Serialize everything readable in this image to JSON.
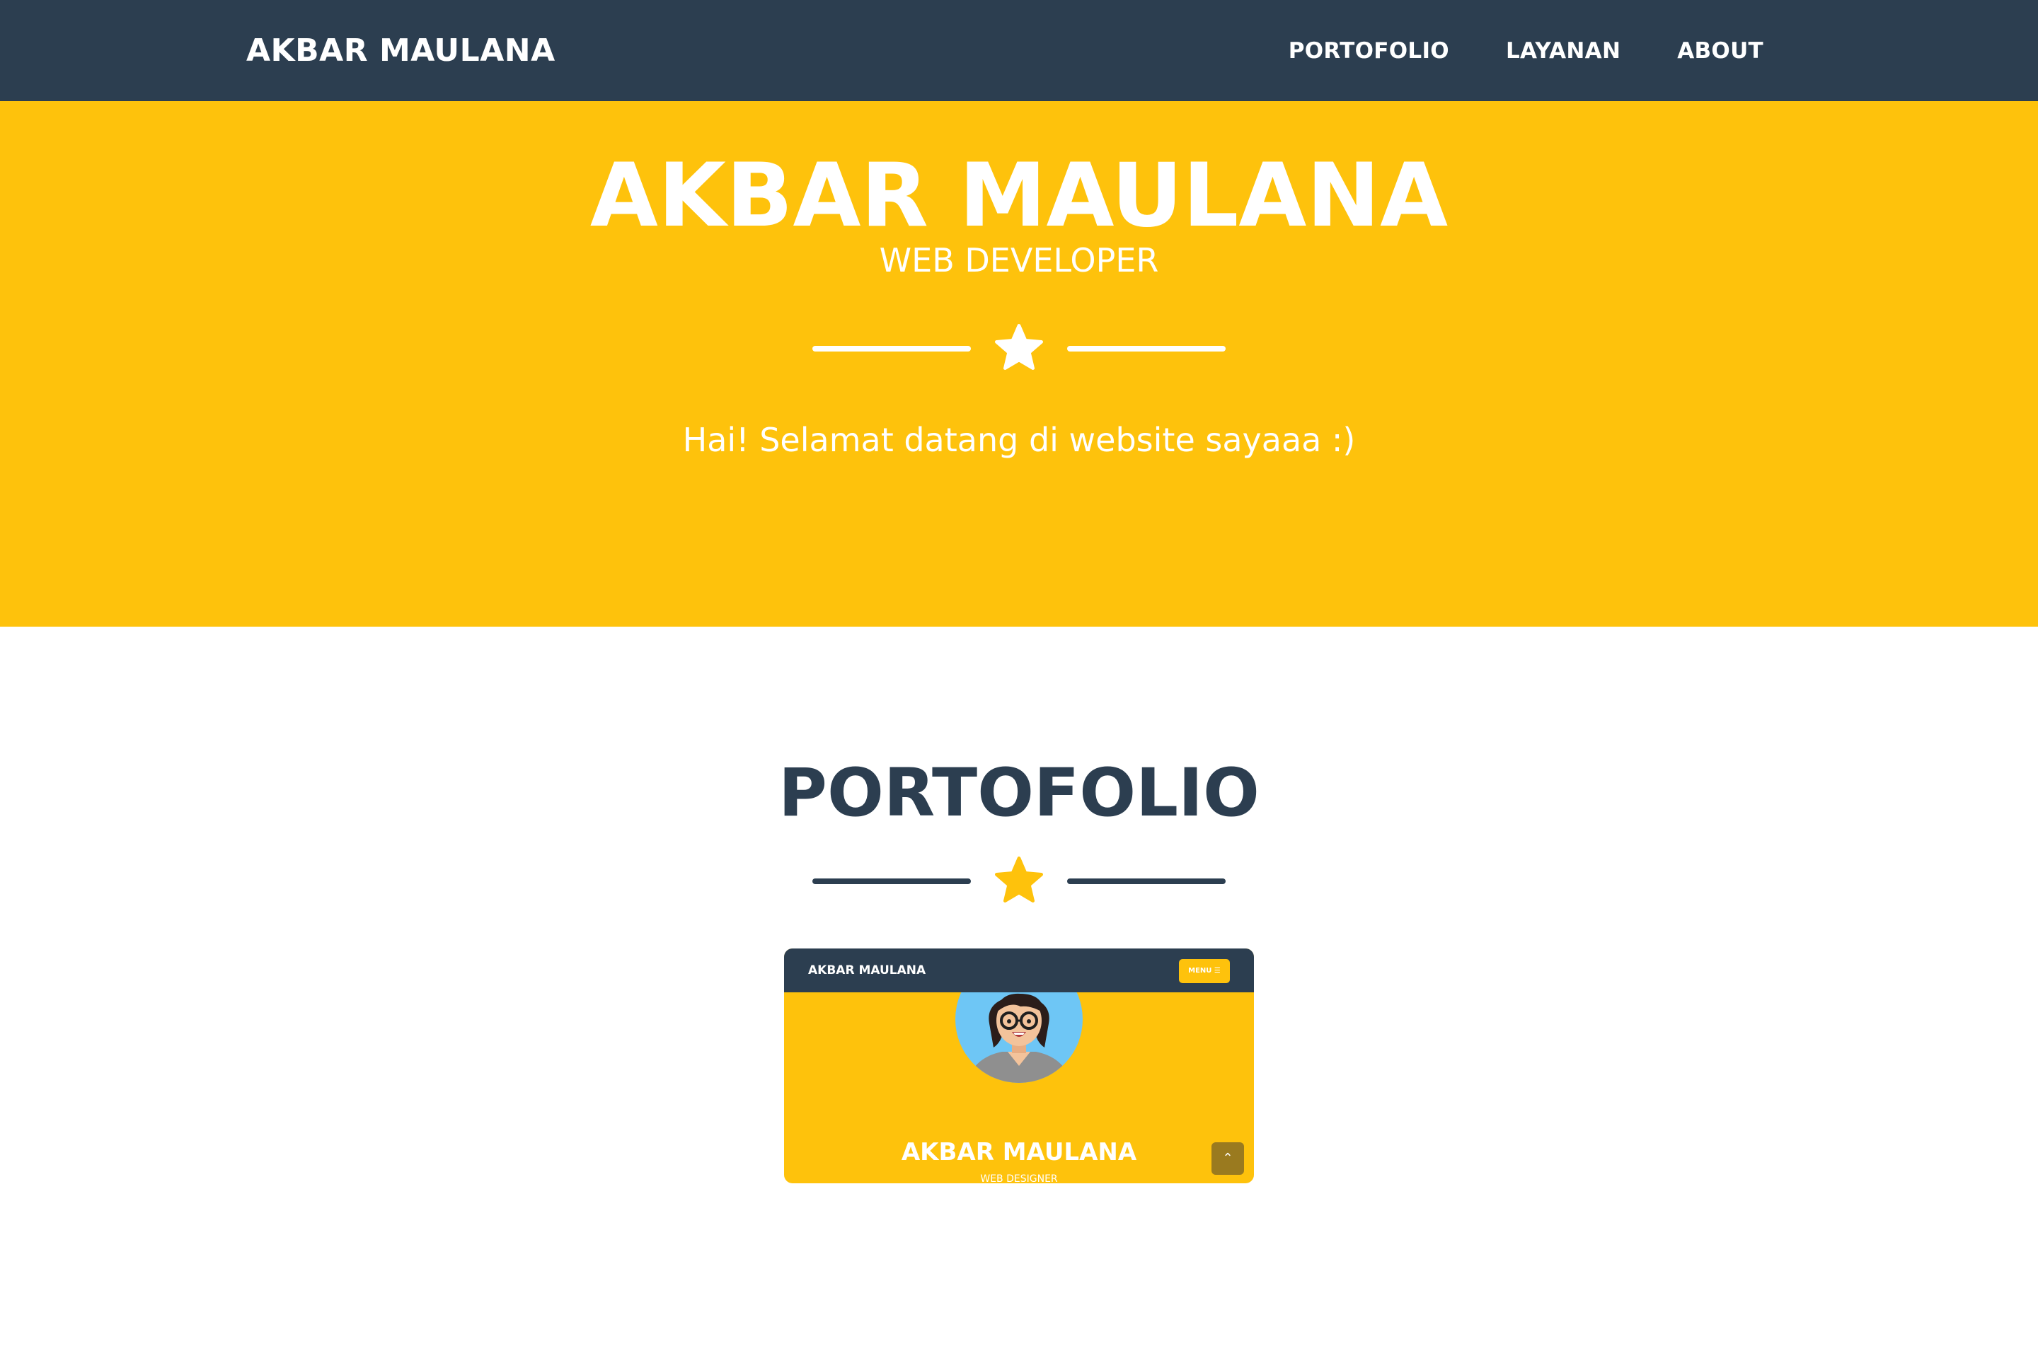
{
  "navbar": {
    "brand": "AKBAR MAULANA",
    "links": [
      "PORTOFOLIO",
      "LAYANAN",
      "ABOUT"
    ]
  },
  "hero": {
    "title": "AKBAR MAULANA",
    "subtitle": "WEB DEVELOPER",
    "divider_icon": "star-icon",
    "text": "Hai! Selamat datang di website sayaaa :)"
  },
  "portfolio": {
    "title": "PORTOFOLIO",
    "divider_icon": "star-icon",
    "items": [
      {
        "brand": "AKBAR MAULANA",
        "menu_label": "MENU ☰",
        "title": "AKBAR MAULANA",
        "subtitle": "WEB DESIGNER",
        "avatar_icon": "avatar-illustration",
        "scroll_icon": "chevron-up-icon"
      }
    ]
  },
  "colors": {
    "navbar": "#2c3e50",
    "accent": "#fec20c",
    "text_dark": "#2c3e50",
    "text_light": "#ffffff"
  }
}
